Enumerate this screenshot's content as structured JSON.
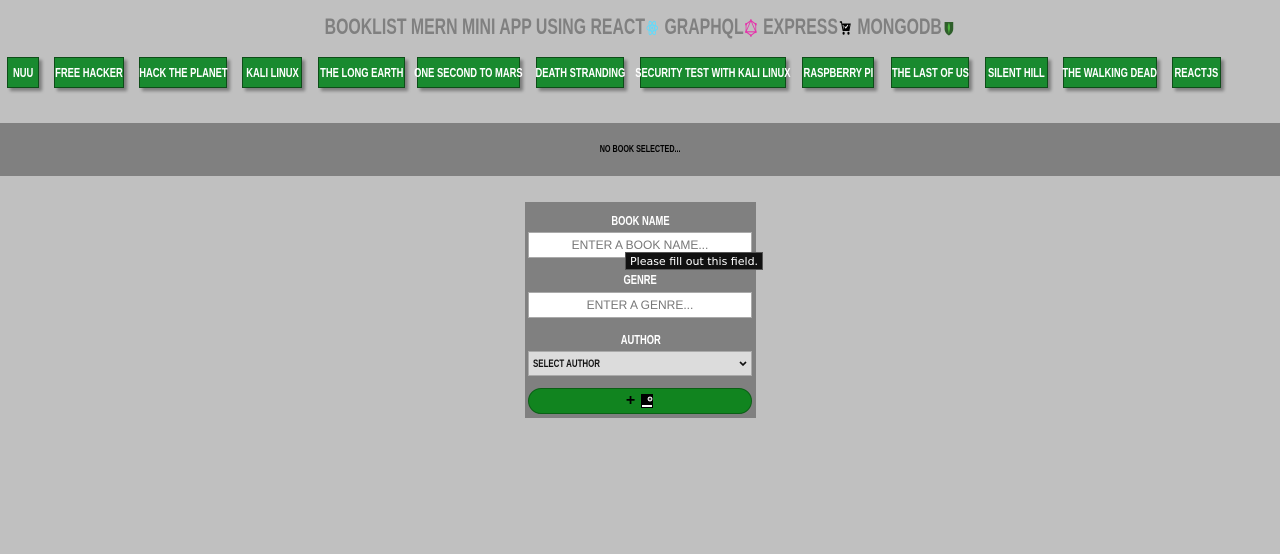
{
  "header": {
    "segments": [
      {
        "text": "BOOKLIST MERN MINI APP USING REACT",
        "icon": "react-icon",
        "color": "#61dafb"
      },
      {
        "text": "GRAPHQL",
        "icon": "graphql-icon",
        "color": "#e535ab"
      },
      {
        "text": "EXPRESS",
        "icon": "express-icon",
        "color": "#000000"
      },
      {
        "text": "MONGODB",
        "icon": "mongodb-icon",
        "color": "#4db33d"
      }
    ]
  },
  "books": [
    {
      "label": "NUU"
    },
    {
      "label": "FREE HACKER"
    },
    {
      "label": "HACK THE PLANET"
    },
    {
      "label": "KALI LINUX"
    },
    {
      "label": "THE LONG EARTH"
    },
    {
      "label": "ONE SECOND TO MARS"
    },
    {
      "label": "DEATH STRANDING"
    },
    {
      "label": "SECURITY TEST WITH KALI LINUX"
    },
    {
      "label": "RASPBERRY PI"
    },
    {
      "label": "THE LAST OF US"
    },
    {
      "label": "SILENT HILL"
    },
    {
      "label": "THE WALKING DEAD"
    },
    {
      "label": "REACTJS"
    }
  ],
  "details": {
    "text": "NO BOOK SELECTED..."
  },
  "form": {
    "book_name_label": "BOOK NAME",
    "book_name_placeholder": "ENTER A BOOK NAME...",
    "genre_label": "GENRE",
    "genre_placeholder": "ENTER A GENRE...",
    "author_label": "AUTHOR",
    "author_selected": "SELECT AUTHOR",
    "add_button_label": "+",
    "add_button_icon": "book-icon"
  },
  "tooltip": {
    "text": "Please fill out this field."
  },
  "colors": {
    "background": "#c0c0c0",
    "panel": "#808080",
    "button_green": "#198a2f",
    "add_green": "#11841f"
  }
}
